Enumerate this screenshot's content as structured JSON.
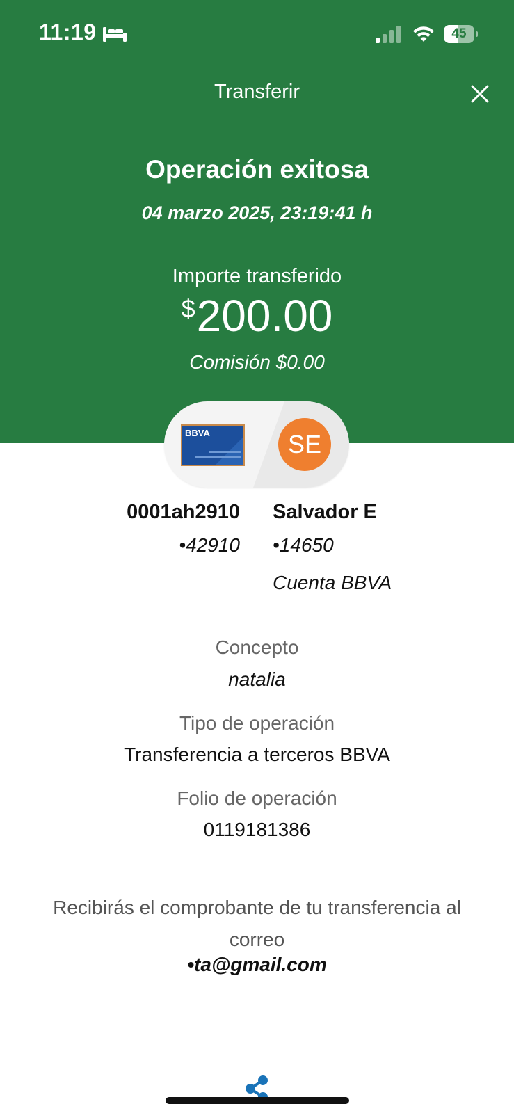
{
  "status_bar": {
    "time": "11:19",
    "battery_level": "45",
    "battery_fraction": 0.45,
    "icons": [
      "bed-icon",
      "signal-icon",
      "wifi-icon",
      "battery-icon"
    ]
  },
  "header": {
    "title": "Transferir",
    "close_icon": "close-icon",
    "background_color": "#277c41"
  },
  "result": {
    "title": "Operación exitosa",
    "date": "04 marzo 2025, 23:19:41 h",
    "amount_label": "Importe transferido",
    "currency_symbol": "$",
    "amount": "200.00",
    "commission": "Comisión  $0.00"
  },
  "origin": {
    "logo_text": "BBVA",
    "name": "0001ah2910",
    "account": "•42910"
  },
  "destination": {
    "initials": "SE",
    "avatar_color": "#ef7f2f",
    "name": "Salvador E",
    "account": "•14650",
    "bank": "Cuenta BBVA"
  },
  "details": {
    "concept_label": "Concepto",
    "concept_value": "natalia",
    "type_label": "Tipo de operación",
    "type_value": "Transferencia a terceros BBVA",
    "folio_label": "Folio de operación",
    "folio_value": "0119181386"
  },
  "notice": {
    "text": "Recibirás el comprobante de tu transferencia al correo",
    "email": "•ta@gmail.com"
  },
  "footer": {
    "share_icon": "share-icon",
    "accent_color": "#1973b8"
  }
}
